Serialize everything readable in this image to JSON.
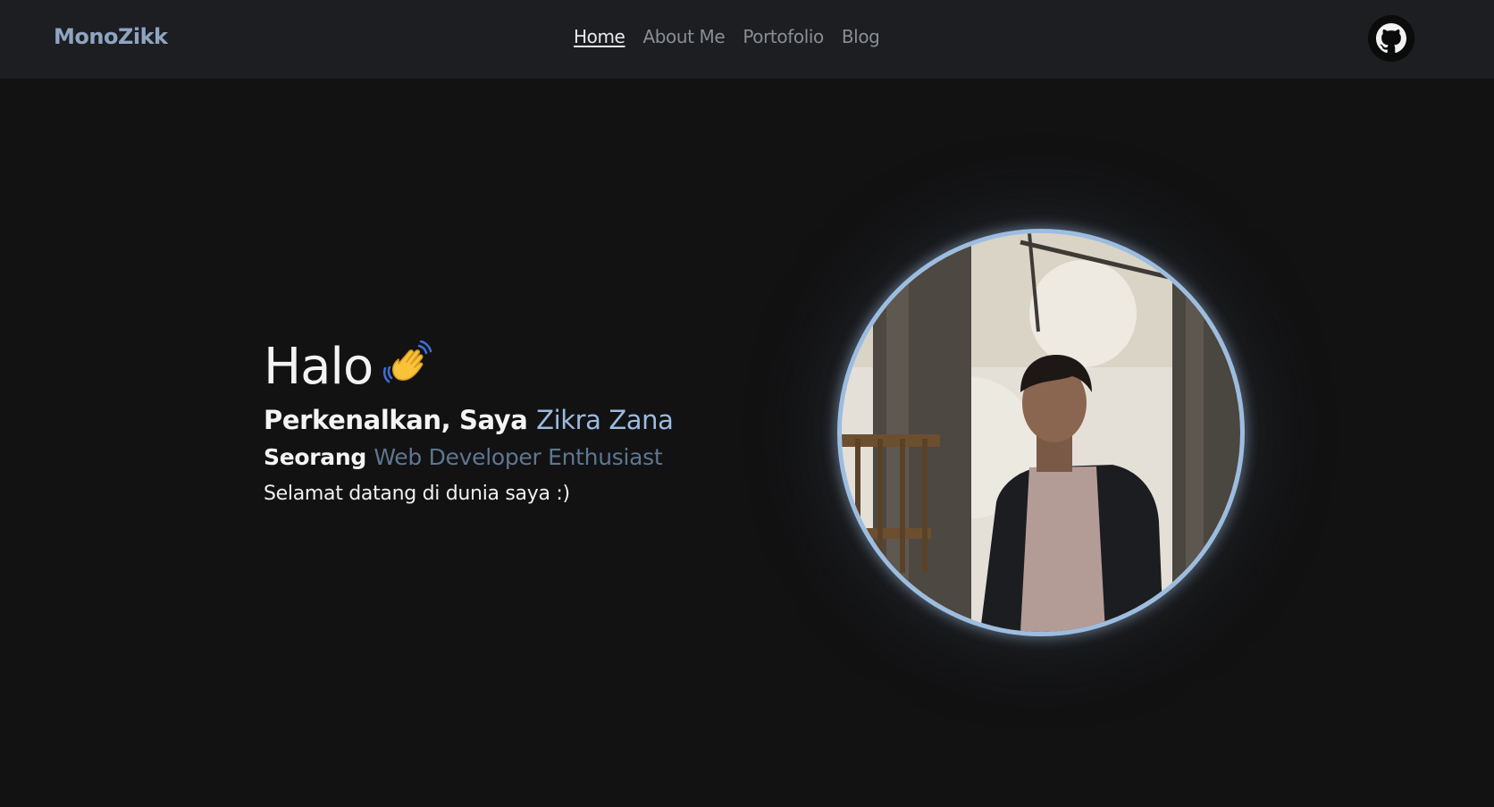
{
  "navbar": {
    "brand": "MonoZikk",
    "links": [
      {
        "label": "Home",
        "active": true
      },
      {
        "label": "About Me",
        "active": false
      },
      {
        "label": "Portofolio",
        "active": false
      },
      {
        "label": "Blog",
        "active": false
      }
    ],
    "github_icon": "github-icon"
  },
  "hero": {
    "greeting": "Halo",
    "wave_icon": "waving-hand-icon",
    "intro_prefix": "Perkenalkan, Saya",
    "name": "Zikra Zana",
    "role_prefix": "Seorang",
    "role": "Web Developer Enthusiast",
    "welcome": "Selamat datang di dunia saya :)"
  },
  "colors": {
    "background": "#121213",
    "navbar": "#1c1e21",
    "brand": "#8ea4c0",
    "accent": "#9bbbe0",
    "muted_accent": "#5f7690",
    "portrait_border": "#9dbde0"
  }
}
